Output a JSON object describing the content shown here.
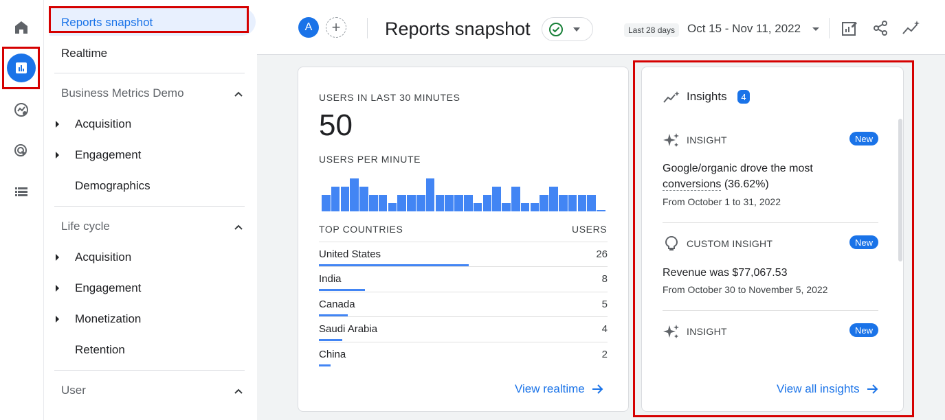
{
  "nav": {
    "top": [
      {
        "label": "Reports snapshot"
      },
      {
        "label": "Realtime"
      }
    ],
    "sections": [
      {
        "title": "Business Metrics Demo",
        "items": [
          {
            "label": "Acquisition",
            "expandable": true
          },
          {
            "label": "Engagement",
            "expandable": true
          },
          {
            "label": "Demographics",
            "expandable": false
          }
        ]
      },
      {
        "title": "Life cycle",
        "items": [
          {
            "label": "Acquisition",
            "expandable": true
          },
          {
            "label": "Engagement",
            "expandable": true
          },
          {
            "label": "Monetization",
            "expandable": true
          },
          {
            "label": "Retention",
            "expandable": false
          }
        ]
      },
      {
        "title": "User",
        "items": []
      }
    ]
  },
  "header": {
    "avatar_letter": "A",
    "add_comparison": "+",
    "title": "Reports snapshot",
    "date_chip": "Last 28 days",
    "date_range": "Oct 15 - Nov 11, 2022"
  },
  "realtime_card": {
    "users_label": "USERS IN LAST 30 MINUTES",
    "users_value": "50",
    "per_minute_label": "USERS PER MINUTE",
    "per_minute_values": [
      2,
      3,
      3,
      4,
      3,
      2,
      2,
      1,
      2,
      2,
      2,
      4,
      2,
      2,
      2,
      2,
      1,
      2,
      3,
      1,
      3,
      1,
      1,
      2,
      3,
      2,
      2,
      2,
      2,
      0.2
    ],
    "countries_header": "TOP COUNTRIES",
    "users_header": "USERS",
    "countries": [
      {
        "name": "United States",
        "value": "26",
        "share": 0.52
      },
      {
        "name": "India",
        "value": "8",
        "share": 0.16
      },
      {
        "name": "Canada",
        "value": "5",
        "share": 0.1
      },
      {
        "name": "Saudi Arabia",
        "value": "4",
        "share": 0.08
      },
      {
        "name": "China",
        "value": "2",
        "share": 0.04
      }
    ],
    "link": "View realtime"
  },
  "insights_card": {
    "title": "Insights",
    "count": "4",
    "items": [
      {
        "type": "INSIGHT",
        "badge": "New",
        "headline_a": "Google/organic drove the most",
        "headline_b": "conversions",
        "headline_c": " (36.62%)",
        "sub": "From October 1 to 31, 2022"
      },
      {
        "type": "CUSTOM INSIGHT",
        "badge": "New",
        "headline": "Revenue was $77,067.53",
        "sub": "From October 30 to November 5, 2022"
      },
      {
        "type": "INSIGHT",
        "badge": "New"
      }
    ],
    "link": "View all insights"
  },
  "colors": {
    "accent": "#1a73e8",
    "bar": "#4285f4",
    "highlight": "#d50000"
  }
}
